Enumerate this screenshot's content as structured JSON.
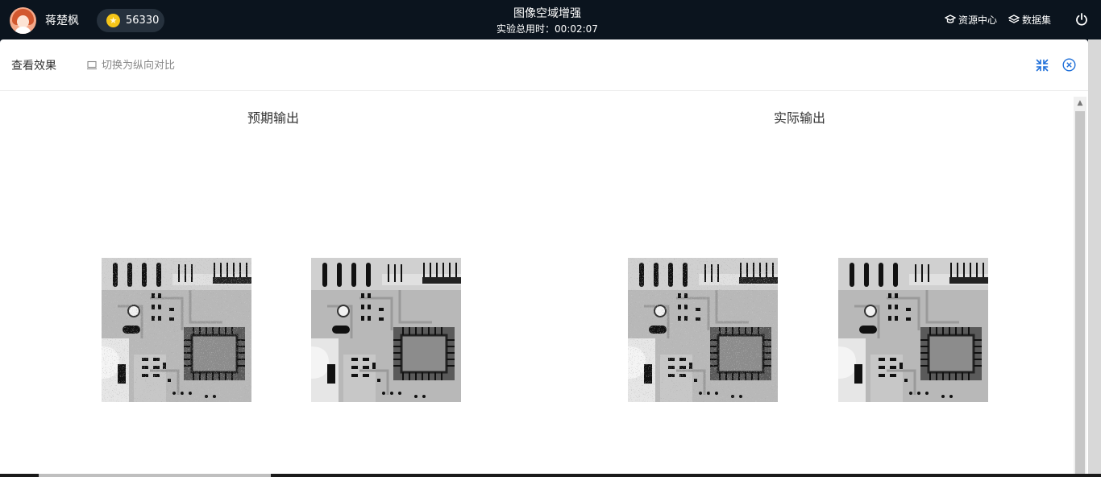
{
  "user": {
    "name": "蒋楚枫",
    "avatar_icon": "user-avatar"
  },
  "coins": {
    "value": "56330",
    "icon": "gold-coin-icon"
  },
  "header": {
    "title": "图像空域增强",
    "timer": "实验总用时：00:02:07"
  },
  "nav": {
    "resources_label": "资源中心",
    "resources_icon": "graduation-cap-icon",
    "datasets_label": "数据集",
    "datasets_icon": "layers-icon",
    "power_icon": "power-icon"
  },
  "panel": {
    "title": "查看效果",
    "toggle_label": "切换为纵向对比",
    "toggle_icon": "layout-toggle-icon",
    "collapse_icon": "collapse-icon",
    "close_icon": "close-circle-icon"
  },
  "compare": {
    "expected_title": "预期输出",
    "actual_title": "实际输出",
    "image_subject": "circuit-board x-ray grayscale image"
  },
  "colors": {
    "topbar_bg": "#0b141e",
    "coin_gold": "#f5c518",
    "accent_blue": "#1e6fd9"
  }
}
